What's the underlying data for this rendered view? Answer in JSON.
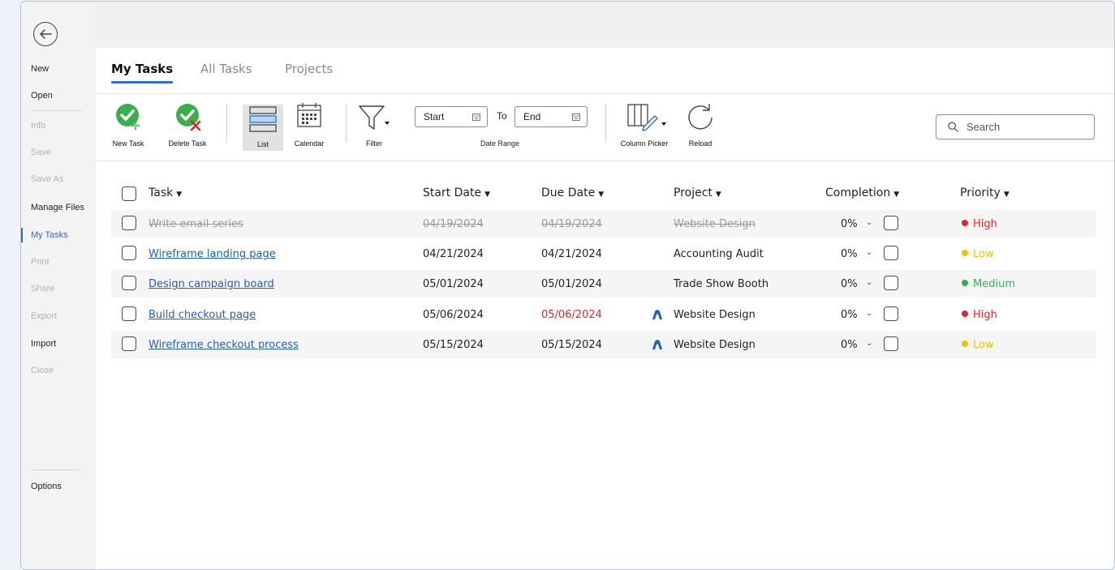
{
  "sidebar": {
    "items": [
      {
        "label": "New",
        "state": "normal"
      },
      {
        "label": "Open",
        "state": "normal"
      },
      {
        "label": "Info",
        "state": "disabled"
      },
      {
        "label": "Save",
        "state": "disabled"
      },
      {
        "label": "Save As",
        "state": "disabled"
      },
      {
        "label": "Manage Files",
        "state": "normal"
      },
      {
        "label": "My Tasks",
        "state": "active"
      },
      {
        "label": "Print",
        "state": "disabled"
      },
      {
        "label": "Share",
        "state": "disabled"
      },
      {
        "label": "Export",
        "state": "disabled"
      },
      {
        "label": "Import",
        "state": "normal"
      },
      {
        "label": "Close",
        "state": "disabled"
      },
      {
        "label": "Options",
        "state": "normal"
      }
    ]
  },
  "tabs": [
    {
      "label": "My Tasks",
      "active": true
    },
    {
      "label": "All Tasks",
      "active": false
    },
    {
      "label": "Projects",
      "active": false
    }
  ],
  "toolbar": {
    "new_task": "New Task",
    "delete_task": "Delete Task",
    "list": "List",
    "calendar": "Calendar",
    "filter": "Filter",
    "start_placeholder": "Start",
    "to": "To",
    "end_placeholder": "End",
    "date_range": "Date Range",
    "column_picker": "Column Picker",
    "reload": "Reload",
    "search_placeholder": "Search"
  },
  "table": {
    "columns": [
      "Task",
      "Start Date",
      "Due Date",
      "Project",
      "Completion",
      "Priority"
    ],
    "rows": [
      {
        "task": "Write email series",
        "start": "04/19/2024",
        "due": "04/19/2024",
        "project": "Website Design",
        "completion": "0%",
        "priority": "High",
        "done": true,
        "overdue": false,
        "project_icon": false
      },
      {
        "task": "Wireframe landing page",
        "start": "04/21/2024",
        "due": "04/21/2024",
        "project": "Accounting Audit",
        "completion": "0%",
        "priority": "Low",
        "done": false,
        "overdue": false,
        "project_icon": false
      },
      {
        "task": "Design campaign board",
        "start": "05/01/2024",
        "due": "05/01/2024",
        "project": "Trade Show Booth",
        "completion": "0%",
        "priority": "Medium",
        "done": false,
        "overdue": false,
        "project_icon": false
      },
      {
        "task": "Build checkout page",
        "start": "05/06/2024",
        "due": "05/06/2024",
        "project": "Website Design",
        "completion": "0%",
        "priority": "High",
        "done": false,
        "overdue": true,
        "project_icon": true
      },
      {
        "task": "Wireframe checkout process",
        "start": "05/15/2024",
        "due": "05/15/2024",
        "project": "Website Design",
        "completion": "0%",
        "priority": "Low",
        "done": false,
        "overdue": false,
        "project_icon": true
      }
    ]
  },
  "colors": {
    "accent": "#2a6fd3",
    "link": "#1f5fc2",
    "overdue": "#d42a2a",
    "priority_high": "#e0262b",
    "priority_low": "#f2c200",
    "priority_medium": "#3aae4a",
    "check_green": "#3aae4a"
  }
}
